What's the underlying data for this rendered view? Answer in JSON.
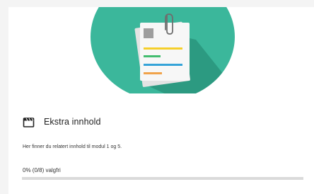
{
  "module": {
    "title": "Ekstra innhold",
    "description": "Her finner du relatert innhold til modul 1 og 5.",
    "progress_text": "0% (0/8) valgfri",
    "progress_fraction": 0.0,
    "icon": "clapperboard-icon"
  },
  "hero": {
    "illustration": "documents-with-paperclip-icon",
    "circle_color": "#3bb79b",
    "shadow_color": "#2c9a81"
  },
  "colors": {
    "progress_track": "#dadada",
    "progress_fill": "#2ab09a",
    "accent_yellow": "#f5cf2a",
    "accent_green": "#43bd6f",
    "accent_blue": "#35a3d8",
    "accent_orange": "#f0a34a"
  }
}
